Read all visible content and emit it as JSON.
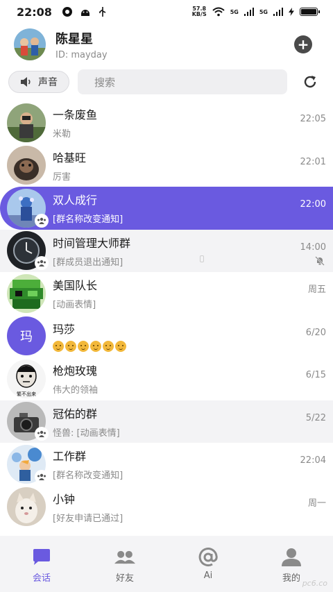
{
  "status_bar": {
    "time": "22:08",
    "net_speed_value": "57.8",
    "net_speed_unit": "KB/S",
    "signal_1": "5G",
    "signal_2": "5G"
  },
  "header": {
    "name": "陈星星",
    "user_id": "ID: mayday"
  },
  "toolbar": {
    "sound_label": "声音",
    "search_placeholder": "搜索"
  },
  "conversations": [
    {
      "title": "一条废鱼",
      "subtitle": "米勒",
      "time": "22:05",
      "group": false
    },
    {
      "title": "哈基旺",
      "subtitle": "厉害",
      "time": "22:01",
      "group": false
    },
    {
      "title": "双人成行",
      "subtitle": "[群名称改变通知]",
      "time": "22:00",
      "group": true
    },
    {
      "title": "时间管理大师群",
      "subtitle": "[群成员退出通知]",
      "time": "14:00",
      "group": true,
      "muted": true
    },
    {
      "title": "美国队长",
      "subtitle": "[动画表情]",
      "time": "周五",
      "group": false
    },
    {
      "title": "玛莎",
      "subtitle": "",
      "time": "6/20",
      "group": false,
      "avatar_letter": "玛",
      "emoji_count": 6
    },
    {
      "title": "枪炮玫瑰",
      "subtitle": "伟大的领袖",
      "time": "6/15",
      "group": false
    },
    {
      "title": "冠佑的群",
      "subtitle": "怪兽: [动画表情]",
      "time": "5/22",
      "group": true
    },
    {
      "title": "工作群",
      "subtitle": "[群名称改变通知]",
      "time": "22:04",
      "group": true
    },
    {
      "title": "小钟",
      "subtitle": "[好友申请已通过]",
      "time": "周一",
      "group": false
    }
  ],
  "avatar_3_caption": "繁不出来",
  "bottom_nav": [
    {
      "label": "会话",
      "icon": "chat-bubble-icon",
      "active": true
    },
    {
      "label": "好友",
      "icon": "friends-icon",
      "active": false
    },
    {
      "label": "Ai",
      "icon": "at-sign-icon",
      "active": false
    },
    {
      "label": "我的",
      "icon": "person-icon",
      "active": false
    }
  ],
  "colors": {
    "accent": "#6a5ae0",
    "selected_row": "#6a5ae0",
    "grey_row": "#f3f3f5"
  },
  "watermark": "pc6.co"
}
